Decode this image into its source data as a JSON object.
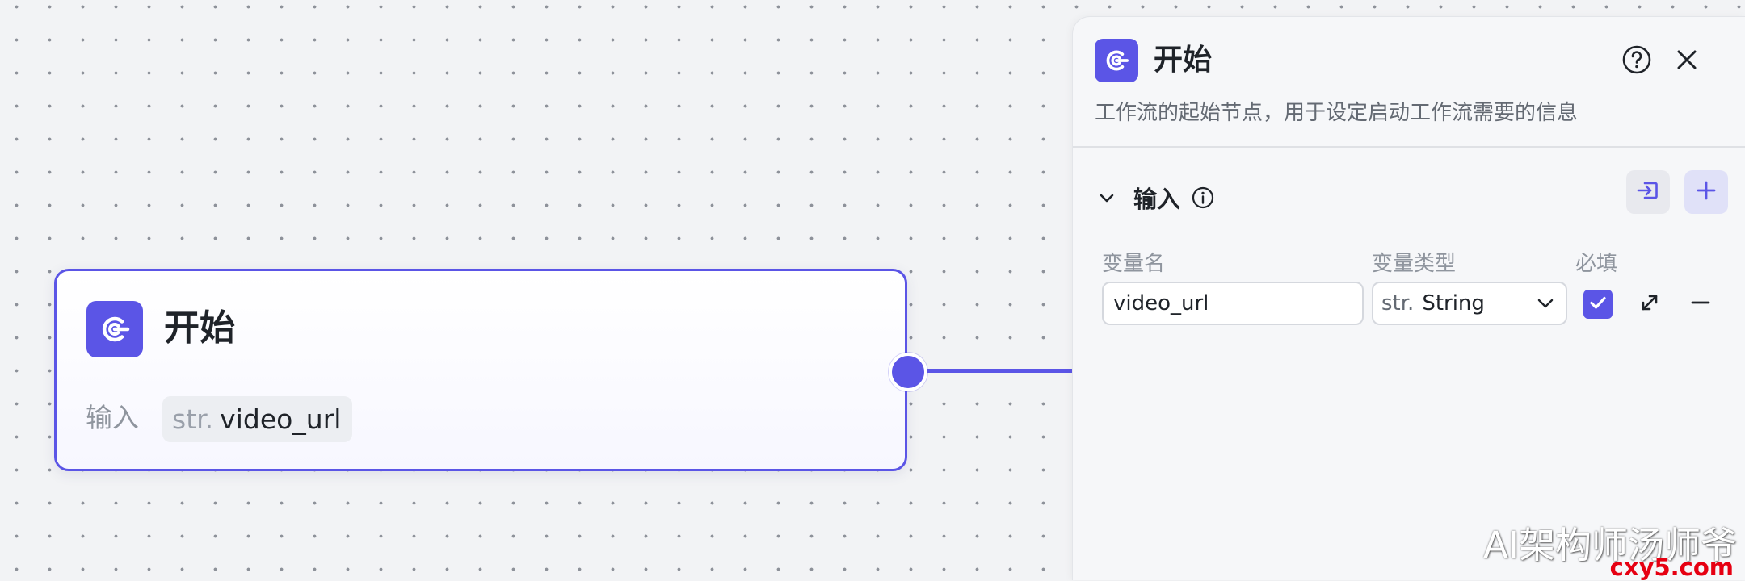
{
  "canvas": {
    "node": {
      "title": "开始",
      "icon": "start-node-icon",
      "inputs_label": "输入",
      "variable": {
        "type_prefix": "str.",
        "name": "video_url"
      }
    }
  },
  "panel": {
    "title": "开始",
    "icon": "start-node-icon",
    "description": "工作流的起始节点，用于设定启动工作流需要的信息",
    "help_icon": "help-circle-icon",
    "close_icon": "close-icon",
    "inputs_section": {
      "title": "输入",
      "info_icon": "info-icon",
      "import_icon": "import-icon",
      "add_icon": "plus-icon",
      "columns": {
        "name": "变量名",
        "type": "变量类型",
        "required": "必填"
      },
      "rows": [
        {
          "name": "video_url",
          "type_prefix": "str.",
          "type": "String",
          "required": true
        }
      ]
    }
  },
  "watermark": {
    "text": "AI架构师汤师爷",
    "domain": "cxy5.com"
  },
  "colors": {
    "accent": "#5b55e6",
    "canvas_background": "#f2f3f5",
    "panel_background": "#f6f7f9",
    "muted_text": "#8f959e"
  }
}
